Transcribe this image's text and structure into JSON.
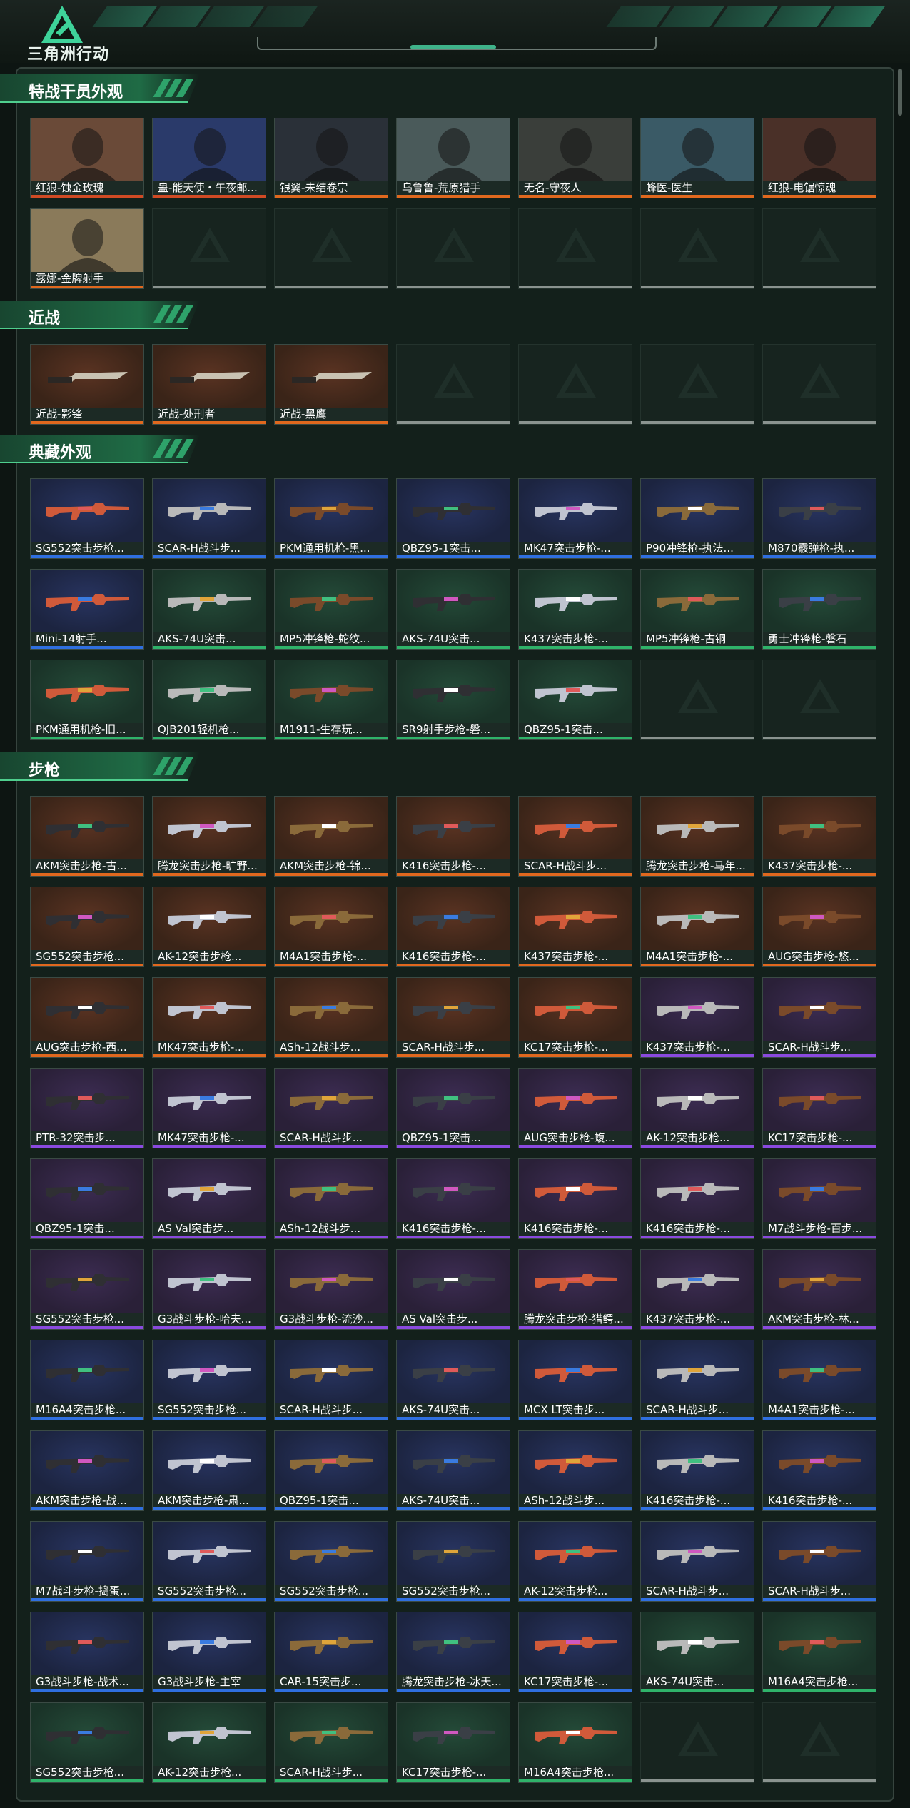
{
  "app": {
    "title": "三角洲行动"
  },
  "sections": [
    {
      "id": "operators",
      "title": "特战干员外观",
      "rarity_color": "#e0681e",
      "items": [
        {
          "label": "红狼-蚀金玫瑰",
          "rarity": "#d04a24"
        },
        {
          "label": "蛊-能天使・午夜邮...",
          "rarity": "#d04a24"
        },
        {
          "label": "银翼-未结卷宗",
          "rarity": "#e0681e"
        },
        {
          "label": "乌鲁鲁-荒原猎手",
          "rarity": "#e0681e"
        },
        {
          "label": "无名-守夜人",
          "rarity": "#e0681e"
        },
        {
          "label": "蜂医-医生",
          "rarity": "#e0681e"
        },
        {
          "label": "红狼-电锯惊魂",
          "rarity": "#e0681e"
        },
        {
          "label": "露娜-金牌射手",
          "rarity": "#e0681e"
        }
      ],
      "empty_count": 6
    },
    {
      "id": "melee",
      "title": "近战",
      "items": [
        {
          "label": "近战-影锋",
          "rarity": "#e0681e"
        },
        {
          "label": "近战-处刑者",
          "rarity": "#e0681e"
        },
        {
          "label": "近战-黑鹰",
          "rarity": "#e0681e"
        }
      ],
      "empty_count": 4
    },
    {
      "id": "collection",
      "title": "典藏外观",
      "items": [
        {
          "label": "SG552突击步枪...",
          "rarity": "#2f6fe0"
        },
        {
          "label": "SCAR-H战斗步...",
          "rarity": "#2f6fe0"
        },
        {
          "label": "PKM通用机枪-黑...",
          "rarity": "#2f6fe0"
        },
        {
          "label": "QBZ95-1突击...",
          "rarity": "#2f6fe0"
        },
        {
          "label": "MK47突击步枪-...",
          "rarity": "#2f6fe0"
        },
        {
          "label": "P90冲锋枪-执法...",
          "rarity": "#2f6fe0"
        },
        {
          "label": "M870霰弹枪-执...",
          "rarity": "#2f6fe0"
        },
        {
          "label": "Mini-14射手...",
          "rarity": "#2f6fe0"
        },
        {
          "label": "AKS-74U突击...",
          "rarity": "#2fb36a"
        },
        {
          "label": "MP5冲锋枪-蛇纹...",
          "rarity": "#2fb36a"
        },
        {
          "label": "AKS-74U突击...",
          "rarity": "#2fb36a"
        },
        {
          "label": "K437突击步枪-...",
          "rarity": "#2fb36a"
        },
        {
          "label": "MP5冲锋枪-古铜",
          "rarity": "#2fb36a"
        },
        {
          "label": "勇士冲锋枪-磐石",
          "rarity": "#2fb36a"
        },
        {
          "label": "PKM通用机枪-旧...",
          "rarity": "#2fb36a"
        },
        {
          "label": "QJB201轻机枪...",
          "rarity": "#2fb36a"
        },
        {
          "label": "M1911-生存玩...",
          "rarity": "#2fb36a"
        },
        {
          "label": "SR9射手步枪-磐...",
          "rarity": "#2fb36a"
        },
        {
          "label": "QBZ95-1突击...",
          "rarity": "#2fb36a"
        }
      ],
      "empty_count": 2
    },
    {
      "id": "rifles",
      "title": "步枪",
      "items": [
        {
          "label": "AKM突击步枪-古...",
          "rarity": "#e0681e"
        },
        {
          "label": "腾龙突击步枪-旷野...",
          "rarity": "#e0681e"
        },
        {
          "label": "AKM突击步枪-锦...",
          "rarity": "#e0681e"
        },
        {
          "label": "K416突击步枪-...",
          "rarity": "#e0681e"
        },
        {
          "label": "SCAR-H战斗步...",
          "rarity": "#e0681e"
        },
        {
          "label": "腾龙突击步枪-马年...",
          "rarity": "#e0681e"
        },
        {
          "label": "K437突击步枪-...",
          "rarity": "#e0681e"
        },
        {
          "label": "SG552突击步枪...",
          "rarity": "#e0681e"
        },
        {
          "label": "AK-12突击步枪...",
          "rarity": "#e0681e"
        },
        {
          "label": "M4A1突击步枪-...",
          "rarity": "#e0681e"
        },
        {
          "label": "K416突击步枪-...",
          "rarity": "#e0681e"
        },
        {
          "label": "K437突击步枪-...",
          "rarity": "#e0681e"
        },
        {
          "label": "M4A1突击步枪-...",
          "rarity": "#e0681e"
        },
        {
          "label": "AUG突击步枪-悠...",
          "rarity": "#e0681e"
        },
        {
          "label": "AUG突击步枪-西...",
          "rarity": "#e0681e"
        },
        {
          "label": "MK47突击步枪-...",
          "rarity": "#e0681e"
        },
        {
          "label": "ASh-12战斗步...",
          "rarity": "#e0681e"
        },
        {
          "label": "SCAR-H战斗步...",
          "rarity": "#e0681e"
        },
        {
          "label": "KC17突击步枪-...",
          "rarity": "#e0681e"
        },
        {
          "label": "K437突击步枪-...",
          "rarity": "#8a4adf"
        },
        {
          "label": "SCAR-H战斗步...",
          "rarity": "#8a4adf"
        },
        {
          "label": "PTR-32突击步...",
          "rarity": "#8a4adf"
        },
        {
          "label": "MK47突击步枪-...",
          "rarity": "#8a4adf"
        },
        {
          "label": "SCAR-H战斗步...",
          "rarity": "#8a4adf"
        },
        {
          "label": "QBZ95-1突击...",
          "rarity": "#8a4adf"
        },
        {
          "label": "AUG突击步枪-蝮...",
          "rarity": "#8a4adf"
        },
        {
          "label": "AK-12突击步枪...",
          "rarity": "#8a4adf"
        },
        {
          "label": "KC17突击步枪-...",
          "rarity": "#8a4adf"
        },
        {
          "label": "QBZ95-1突击...",
          "rarity": "#8a4adf"
        },
        {
          "label": "AS Val突击步...",
          "rarity": "#8a4adf"
        },
        {
          "label": "ASh-12战斗步...",
          "rarity": "#8a4adf"
        },
        {
          "label": "K416突击步枪-...",
          "rarity": "#8a4adf"
        },
        {
          "label": "K416突击步枪-...",
          "rarity": "#8a4adf"
        },
        {
          "label": "K416突击步枪-...",
          "rarity": "#8a4adf"
        },
        {
          "label": "M7战斗步枪-百步...",
          "rarity": "#8a4adf"
        },
        {
          "label": "SG552突击步枪...",
          "rarity": "#8a4adf"
        },
        {
          "label": "G3战斗步枪-哈夫...",
          "rarity": "#8a4adf"
        },
        {
          "label": "G3战斗步枪-流沙...",
          "rarity": "#8a4adf"
        },
        {
          "label": "AS Val突击步...",
          "rarity": "#8a4adf"
        },
        {
          "label": "腾龙突击步枪-猎鳄...",
          "rarity": "#8a4adf"
        },
        {
          "label": "K437突击步枪-...",
          "rarity": "#8a4adf"
        },
        {
          "label": "AKM突击步枪-林...",
          "rarity": "#8a4adf"
        },
        {
          "label": "M16A4突击步枪...",
          "rarity": "#2f6fe0"
        },
        {
          "label": "SG552突击步枪...",
          "rarity": "#2f6fe0"
        },
        {
          "label": "SCAR-H战斗步...",
          "rarity": "#2f6fe0"
        },
        {
          "label": "AKS-74U突击...",
          "rarity": "#2f6fe0"
        },
        {
          "label": "MCX LT突击步...",
          "rarity": "#2f6fe0"
        },
        {
          "label": "SCAR-H战斗步...",
          "rarity": "#2f6fe0"
        },
        {
          "label": "M4A1突击步枪-...",
          "rarity": "#2f6fe0"
        },
        {
          "label": "AKM突击步枪-战...",
          "rarity": "#2f6fe0"
        },
        {
          "label": "AKM突击步枪-肃...",
          "rarity": "#2f6fe0"
        },
        {
          "label": "QBZ95-1突击...",
          "rarity": "#2f6fe0"
        },
        {
          "label": "AKS-74U突击...",
          "rarity": "#2f6fe0"
        },
        {
          "label": "ASh-12战斗步...",
          "rarity": "#2f6fe0"
        },
        {
          "label": "K416突击步枪-...",
          "rarity": "#2f6fe0"
        },
        {
          "label": "K416突击步枪-...",
          "rarity": "#2f6fe0"
        },
        {
          "label": "M7战斗步枪-捣蛋...",
          "rarity": "#2f6fe0"
        },
        {
          "label": "SG552突击步枪...",
          "rarity": "#2f6fe0"
        },
        {
          "label": "SG552突击步枪...",
          "rarity": "#2f6fe0"
        },
        {
          "label": "SG552突击步枪...",
          "rarity": "#2f6fe0"
        },
        {
          "label": "AK-12突击步枪...",
          "rarity": "#2f6fe0"
        },
        {
          "label": "SCAR-H战斗步...",
          "rarity": "#2f6fe0"
        },
        {
          "label": "SCAR-H战斗步...",
          "rarity": "#2f6fe0"
        },
        {
          "label": "G3战斗步枪-战术...",
          "rarity": "#2f6fe0"
        },
        {
          "label": "G3战斗步枪-主宰",
          "rarity": "#2f6fe0"
        },
        {
          "label": "CAR-15突击步...",
          "rarity": "#2f6fe0"
        },
        {
          "label": "腾龙突击步枪-冰天...",
          "rarity": "#2f6fe0"
        },
        {
          "label": "KC17突击步枪-...",
          "rarity": "#2f6fe0"
        },
        {
          "label": "AKS-74U突击...",
          "rarity": "#2fb36a"
        },
        {
          "label": "M16A4突击步枪...",
          "rarity": "#2fb36a"
        },
        {
          "label": "SG552突击步枪...",
          "rarity": "#2fb36a"
        },
        {
          "label": "AK-12突击步枪...",
          "rarity": "#2fb36a"
        },
        {
          "label": "SCAR-H战斗步...",
          "rarity": "#2fb36a"
        },
        {
          "label": "KC17突击步枪-...",
          "rarity": "#2fb36a"
        },
        {
          "label": "M16A4突击步枪...",
          "rarity": "#2fb36a"
        }
      ],
      "empty_count": 2
    }
  ],
  "colors": {
    "accent": "#2ea36a",
    "panel_bg": "#13201b",
    "page_bg": "#0d1512",
    "legendary": "#e0681e",
    "epic": "#8a4adf",
    "rare": "#2f6fe0",
    "uncommon": "#2fb36a"
  }
}
